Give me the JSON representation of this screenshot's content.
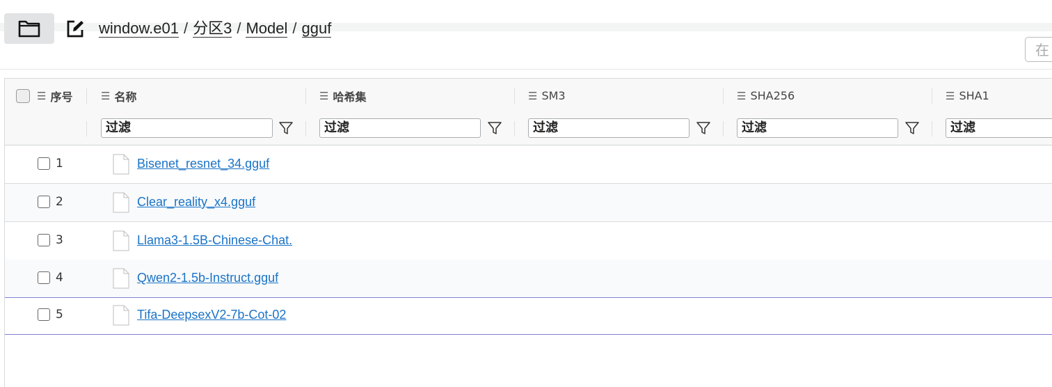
{
  "toolbar": {
    "folder_icon": "folder-icon",
    "edit_icon": "edit-icon",
    "breadcrumb": [
      "window.e01",
      "分区3",
      "Model",
      "gguf"
    ],
    "separator": "/",
    "search_placeholder": "在"
  },
  "grid": {
    "columns": [
      {
        "label": "序号"
      },
      {
        "label": "名称"
      },
      {
        "label": "哈希集"
      },
      {
        "label": "SM3"
      },
      {
        "label": "SHA256"
      },
      {
        "label": "SHA1"
      }
    ],
    "filter_placeholder": "过滤",
    "rows": [
      {
        "index": "1",
        "name": "Bisenet_resnet_34.gguf"
      },
      {
        "index": "2",
        "name": "Clear_reality_x4.gguf"
      },
      {
        "index": "3",
        "name": "Llama3-1.5B-Chinese-Chat."
      },
      {
        "index": "4",
        "name": "Qwen2-1.5b-Instruct.gguf"
      },
      {
        "index": "5",
        "name": "Tifa-DeepsexV2-7b-Cot-02"
      }
    ]
  },
  "colors": {
    "link": "#1a73c7",
    "selection_border": "#7f7fd4"
  }
}
